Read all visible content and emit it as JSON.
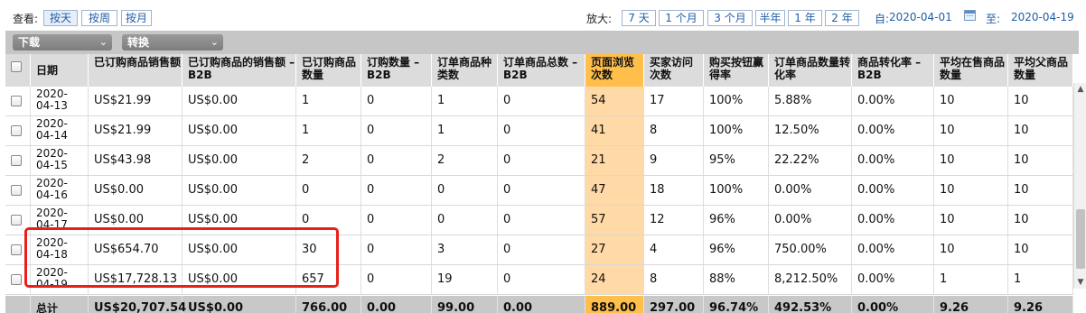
{
  "toolbar": {
    "view_label": "查看:",
    "view_buttons": [
      "按天",
      "按周",
      "按月"
    ],
    "zoom_label": "放大:",
    "zoom_buttons": [
      "7 天",
      "1 个月",
      "3 个月",
      "半年",
      "1 年",
      "2 年"
    ],
    "from_label": "自:",
    "from_date": "2020-04-01",
    "to_label": "至:",
    "to_date": "2020-04-19"
  },
  "dropdowns": {
    "download": "下载",
    "convert": "转换"
  },
  "table": {
    "headers": [
      "日期",
      "已订购商品销售额",
      "已订购商品的销售额 – B2B",
      "已订购商品数量",
      "订购数量 – B2B",
      "订单商品种类数",
      "订单商品总数 – B2B",
      "页面浏览次数",
      "买家访问次数",
      "购买按钮赢得率",
      "订单商品数量转化率",
      "商品转化率 – B2B",
      "平均在售商品数量",
      "平均父商品数量"
    ],
    "rows": [
      {
        "date": [
          "2020-",
          "04-13"
        ],
        "cells": [
          "US$21.99",
          "US$0.00",
          "1",
          "0",
          "1",
          "0",
          "54",
          "17",
          "100%",
          "5.88%",
          "0.00%",
          "10",
          "10"
        ]
      },
      {
        "date": [
          "2020-",
          "04-14"
        ],
        "cells": [
          "US$21.99",
          "US$0.00",
          "1",
          "0",
          "1",
          "0",
          "41",
          "8",
          "100%",
          "12.50%",
          "0.00%",
          "10",
          "10"
        ]
      },
      {
        "date": [
          "2020-",
          "04-15"
        ],
        "cells": [
          "US$43.98",
          "US$0.00",
          "2",
          "0",
          "2",
          "0",
          "21",
          "9",
          "95%",
          "22.22%",
          "0.00%",
          "10",
          "10"
        ]
      },
      {
        "date": [
          "2020-",
          "04-16"
        ],
        "cells": [
          "US$0.00",
          "US$0.00",
          "0",
          "0",
          "0",
          "0",
          "47",
          "18",
          "100%",
          "0.00%",
          "0.00%",
          "10",
          "10"
        ]
      },
      {
        "date": [
          "2020-",
          "04-17"
        ],
        "cells": [
          "US$0.00",
          "US$0.00",
          "0",
          "0",
          "0",
          "0",
          "57",
          "12",
          "96%",
          "0.00%",
          "0.00%",
          "10",
          "10"
        ]
      },
      {
        "date": [
          "2020-",
          "04-18"
        ],
        "cells": [
          "US$654.70",
          "US$0.00",
          "30",
          "0",
          "3",
          "0",
          "27",
          "4",
          "96%",
          "750.00%",
          "0.00%",
          "10",
          "10"
        ]
      },
      {
        "date": [
          "2020-",
          "04-19"
        ],
        "cells": [
          "US$17,728.13",
          "US$0.00",
          "657",
          "0",
          "19",
          "0",
          "24",
          "8",
          "88%",
          "8,212.50%",
          "0.00%",
          "1",
          "1"
        ]
      }
    ],
    "footer": {
      "label": "总计",
      "cells": [
        "US$20,707.54",
        "US$0.00",
        "766.00",
        "0.00",
        "99.00",
        "0.00",
        "889.00",
        "297.00",
        "96.74%",
        "492.53%",
        "0.00%",
        "9.26",
        "9.26"
      ]
    }
  },
  "colors": {
    "highlight_header": "#ffbf4a",
    "highlight_cell": "#ffd9a6",
    "annotation": "#e8201b"
  }
}
